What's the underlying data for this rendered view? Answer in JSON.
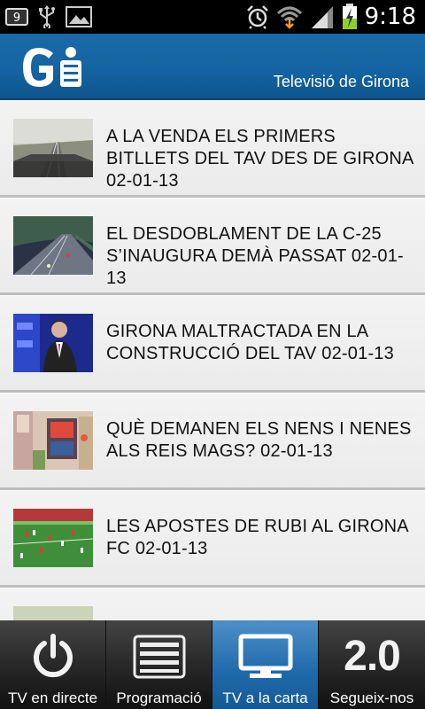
{
  "status_bar": {
    "notification_count": "9",
    "time": "9:18",
    "icons": [
      "usb-icon",
      "image-icon",
      "alarm-icon",
      "wifi-icon",
      "signal-icon",
      "battery-charging-icon"
    ]
  },
  "header": {
    "logo_text": "Gi",
    "channel_name": "Televisió de Girona",
    "color": "#1565a4"
  },
  "news": [
    {
      "title": "A LA VENDA ELS PRIMERS BITLLETS DEL TAV DES DE GIRONA 02-01-13",
      "thumb": "train-track"
    },
    {
      "title": "EL DESDOBLAMENT DE LA C-25 S’INAUGURA DEMÀ PASSAT 02-01-13",
      "thumb": "highway-night"
    },
    {
      "title": "GIRONA MALTRACTADA EN LA CONSTRUCCIÓ DEL TAV 02-01-13",
      "thumb": "tv-studio"
    },
    {
      "title": "QUÈ DEMANEN ELS NENS I NENES ALS REIS MAGS? 02-01-13",
      "thumb": "toy-store"
    },
    {
      "title": "LES APOSTES DE RUBI AL GIRONA FC 02-01-13",
      "thumb": "football-pitch"
    }
  ],
  "bottom_nav": [
    {
      "label": "TV en directe",
      "icon": "power-icon",
      "active": false
    },
    {
      "label": "Programació",
      "icon": "list-icon",
      "active": false
    },
    {
      "label": "TV a la carta",
      "icon": "monitor-icon",
      "active": true
    },
    {
      "label": "Segueix-nos",
      "icon_text": "2.0",
      "active": false
    }
  ]
}
